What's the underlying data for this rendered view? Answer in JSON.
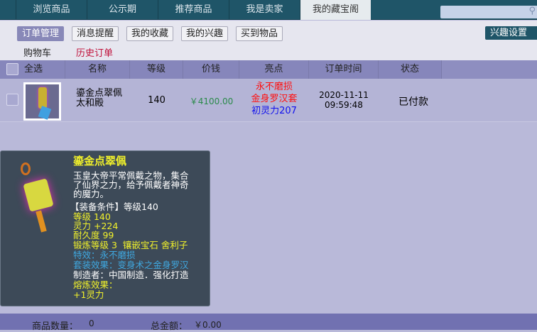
{
  "tabs": [
    "浏览商品",
    "公示期",
    "推荐商品",
    "我是卖家",
    "我的藏宝阁"
  ],
  "search": {
    "placeholder": ""
  },
  "subnav": [
    "订单管理",
    "消息提醒",
    "我的收藏",
    "我的兴趣",
    "买到物品"
  ],
  "interest_settings": "兴趣设置",
  "links": {
    "cart": "购物车",
    "history": "历史订单"
  },
  "table": {
    "headers": [
      "全选",
      "名称",
      "等级",
      "价钱",
      "亮点",
      "订单时间",
      "状态"
    ],
    "rows": [
      {
        "name1": "鎏金点翠佩",
        "name2": "太和殿",
        "level": "140",
        "price": "￥4100.00",
        "highlights": [
          "永不磨损",
          "金身罗汉套",
          "初灵力207"
        ],
        "date": "2020-11-11",
        "time": "09:59:48",
        "status": "已付款"
      }
    ]
  },
  "tooltip": {
    "title": "鎏金点翠佩",
    "desc": [
      "玉皇大帝平常佩戴之物，集合",
      "了仙界之力，给予佩戴者神奇",
      "的魔力。"
    ],
    "req": "【装备条件】等级140",
    "stats": [
      "等级 140",
      "灵力 +224",
      "耐久度 99",
      "锻炼等级 3  镶嵌宝石 舍利子"
    ],
    "effects": [
      "特效：永不磨损",
      "套装效果：变身术之金身罗汉"
    ],
    "maker": "制造者：中国制造．强化打造",
    "melt": [
      "熔炼效果：",
      "+1灵力"
    ]
  },
  "footer": {
    "count_label": "商品数量：",
    "count": "0",
    "total_label": "总金额：",
    "total": "￥0.00"
  },
  "colors": {
    "topbar": "#1f5568",
    "red": "#ff1010",
    "blue": "#1010ee",
    "green": "#2a8a4a",
    "yellow": "#f2f22a",
    "cyan": "#3fa8e0"
  }
}
